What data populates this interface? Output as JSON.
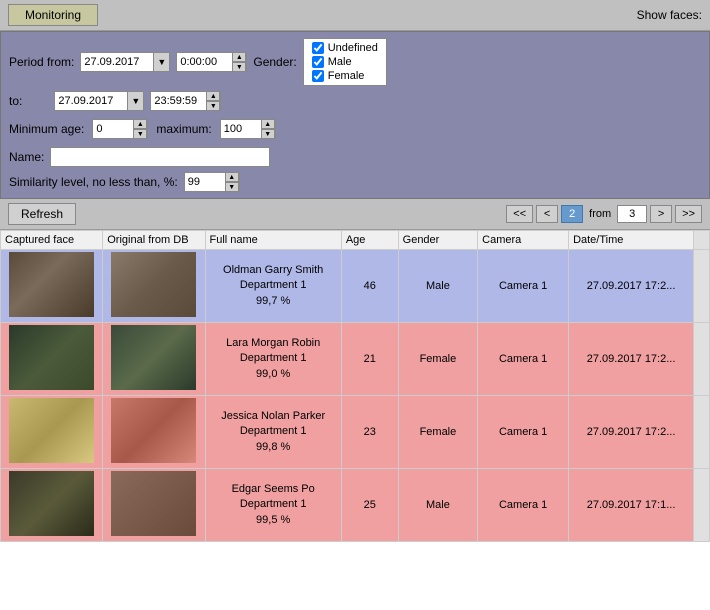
{
  "titleBar": {
    "tabLabel": "Monitoring",
    "showFacesLabel": "Show faces:"
  },
  "filters": {
    "periodFromLabel": "Period from:",
    "toLabel": "to:",
    "dateFrom": "27.09.2017",
    "timeFrom": "0:00:00",
    "dateTo": "27.09.2017",
    "timeTo": "23:59:59",
    "genderLabel": "Gender:",
    "genderOptions": [
      {
        "label": "Undefined",
        "checked": true
      },
      {
        "label": "Male",
        "checked": true
      },
      {
        "label": "Female",
        "checked": true
      }
    ],
    "minAgeLabel": "Minimum age:",
    "minAge": "0",
    "maxAgeLabel": "maximum:",
    "maxAge": "100",
    "nameLabel": "Name:",
    "namePlaceholder": "",
    "similarityLabel": "Similarity level, no less than, %:",
    "similarityValue": "99"
  },
  "controls": {
    "refreshLabel": "Refresh",
    "pagination": {
      "firstLabel": "<<",
      "prevLabel": "<",
      "currentPage": "2",
      "fromLabel": "from",
      "totalPages": "3",
      "nextLabel": ">",
      "lastLabel": ">>"
    }
  },
  "table": {
    "headers": [
      "Captured face",
      "Original from DB",
      "Full name",
      "Age",
      "Gender",
      "Camera",
      "Date/Time"
    ],
    "rows": [
      {
        "rowClass": "row-blue",
        "capturedFaceClass": "face-captured-1",
        "dbFaceClass": "face-db-1",
        "fullName": "Oldman Garry Smith\nDepartment 1\n99,7 %",
        "age": "46",
        "gender": "Male",
        "camera": "Camera 1",
        "datetime": "27.09.2017 17:2..."
      },
      {
        "rowClass": "row-pink",
        "capturedFaceClass": "face-captured-2",
        "dbFaceClass": "face-db-2",
        "fullName": "Lara Morgan Robin\nDepartment 1\n99,0 %",
        "age": "21",
        "gender": "Female",
        "camera": "Camera 1",
        "datetime": "27.09.2017 17:2..."
      },
      {
        "rowClass": "row-pink",
        "capturedFaceClass": "face-captured-3",
        "dbFaceClass": "face-db-3",
        "fullName": "Jessica Nolan Parker\nDepartment 1\n99,8 %",
        "age": "23",
        "gender": "Female",
        "camera": "Camera 1",
        "datetime": "27.09.2017 17:2..."
      },
      {
        "rowClass": "row-pink",
        "capturedFaceClass": "face-captured-4",
        "dbFaceClass": "face-db-4",
        "fullName": "Edgar Seems Po\nDepartment 1\n99,5 %",
        "age": "25",
        "gender": "Male",
        "camera": "Camera 1",
        "datetime": "27.09.2017 17:1..."
      }
    ]
  }
}
